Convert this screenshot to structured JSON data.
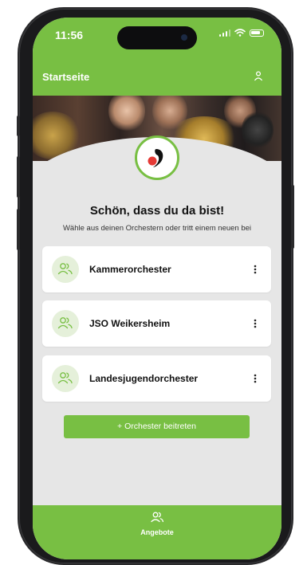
{
  "status_bar": {
    "time": "11:56"
  },
  "app_bar": {
    "title": "Startseite",
    "profile_icon": "user-icon"
  },
  "welcome": {
    "title": "Schön, dass du da bist!",
    "subtitle": "Wähle aus deinen Orchestern oder tritt einem neuen bei"
  },
  "orchestras": [
    {
      "name": "Kammerorchester",
      "icon": "users-icon"
    },
    {
      "name": "JSO Weikersheim",
      "icon": "users-icon"
    },
    {
      "name": "Landesjugendorchester",
      "icon": "users-icon"
    }
  ],
  "join_button": {
    "label": "+   Orchester beitreten"
  },
  "bottom_nav": {
    "items": [
      {
        "label": "Angebote",
        "icon": "users-icon"
      }
    ]
  },
  "colors": {
    "primary": "#78bf43",
    "background": "#e6e6e6",
    "icon_bg": "#e5f0da",
    "logo_red": "#e53935"
  }
}
